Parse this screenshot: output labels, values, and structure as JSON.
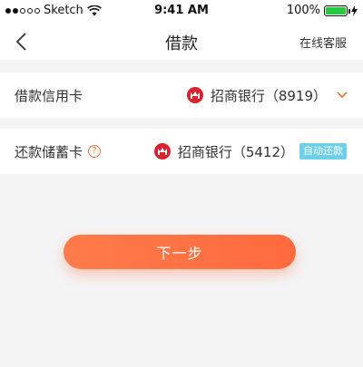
{
  "status_bar": {
    "carrier": "Sketch",
    "time": "9:41 AM",
    "battery_percent": "100%",
    "battery_level": 1.0,
    "battery_color": "#27c93f"
  },
  "nav": {
    "title": "借款",
    "right_action": "在线客服",
    "back_icon": "chevron-left-icon"
  },
  "credit_card_row": {
    "label": "借款信用卡",
    "bank_name": "招商银行（8919）",
    "bank_icon": "cmb-bank-logo-icon",
    "expand_icon": "chevron-down-icon"
  },
  "debit_card_row": {
    "label": "还款储蓄卡",
    "help_icon": "question-circle-icon",
    "bank_name": "招商银行（5412）",
    "bank_icon": "cmb-bank-logo-icon",
    "badge": "自动还款"
  },
  "next_button": {
    "label": "下一步"
  },
  "colors": {
    "accent": "#ff6a3d",
    "badge": "#6ecfe8",
    "bank_logo": "#d9232e"
  }
}
